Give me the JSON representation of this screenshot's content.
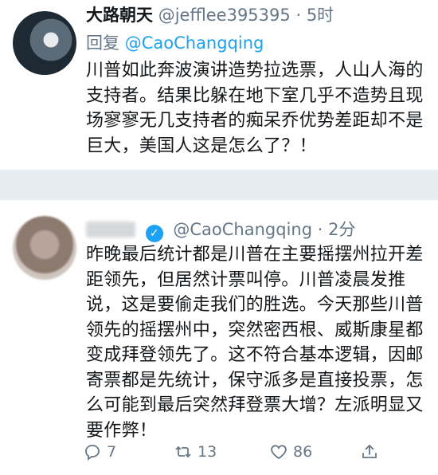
{
  "tweet1": {
    "name": "大路朝天",
    "handle": "@jefflee395395",
    "dot": "·",
    "time": "5时",
    "reply_prefix": "回复",
    "reply_to": "@CaoChangqing",
    "text": "川普如此奔波演讲造势拉选票，人山人海的支持者。结果比躲在地下室几乎不造势且现场寥寥无几支持者的痴呆乔优势差距却不是巨大，美国人这是怎么了？！"
  },
  "tweet2": {
    "handle": "@CaoChangqing",
    "dot": "·",
    "time": "2分",
    "text": "昨晚最后统计都是川普在主要摇摆州拉开差距领先，但居然计票叫停。川普凌晨发推说，这是要偷走我们的胜选。今天那些川普领先的摇摆州中，突然密西根、威斯康星都变成拜登领先了。这不符合基本逻辑，因邮寄票都是先统计，保守派多是直接投票，怎么可能到最后突然拜登票大增？左派明显又要作弊！",
    "actions": {
      "reply_count": "7",
      "retweet_count": "13",
      "like_count": "86"
    }
  },
  "colors": {
    "accent": "#1da1f2",
    "secondary_text": "#657786",
    "divider": "#e6ecf0"
  }
}
